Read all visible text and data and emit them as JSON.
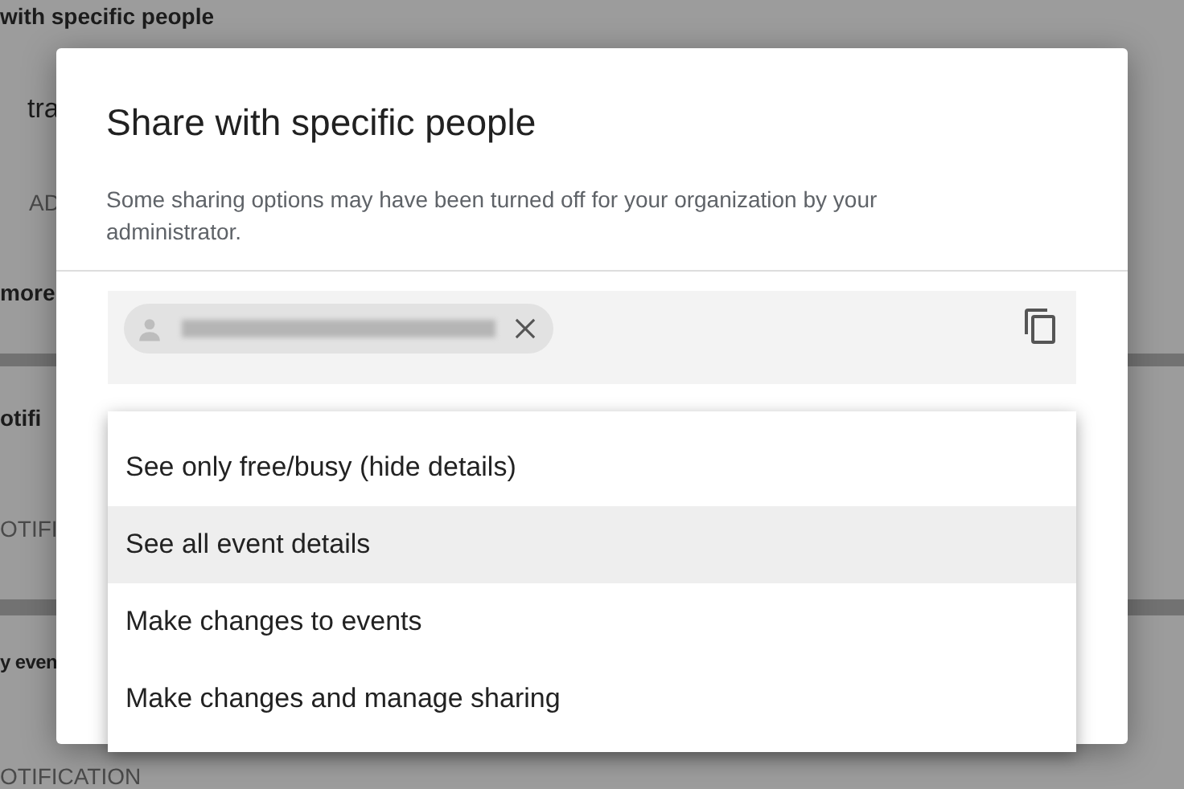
{
  "background": {
    "sections": [
      {
        "items": [
          {
            "text": "with specific people",
            "kind": "heading"
          },
          {
            "text": "tra",
            "kind": "value"
          },
          {
            "text": "AD",
            "kind": "caps"
          },
          {
            "text": "more",
            "kind": "heading"
          }
        ]
      },
      {
        "items": [
          {
            "text": "otifi",
            "kind": "heading"
          },
          {
            "text": "OTIFI",
            "kind": "caps"
          }
        ]
      },
      {
        "items": [
          {
            "text": "y even",
            "kind": "heading"
          },
          {
            "text": "OTIFICATION",
            "kind": "caps"
          }
        ]
      }
    ]
  },
  "dialog": {
    "title": "Share with specific people",
    "note": "Some sharing options may have been turned off for your organization by your administrator.",
    "menu": [
      {
        "label": "See only free/busy (hide details)",
        "selected": false
      },
      {
        "label": "See all event details",
        "selected": true
      },
      {
        "label": "Make changes to events",
        "selected": false
      },
      {
        "label": "Make changes and manage sharing",
        "selected": false
      }
    ]
  }
}
